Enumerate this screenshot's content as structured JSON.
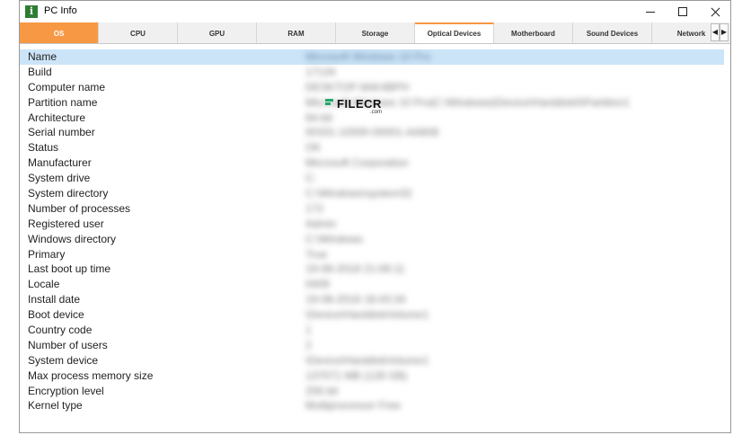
{
  "window": {
    "title": "PC Info",
    "app_icon_letter": "i"
  },
  "tabs": [
    {
      "label": "OS",
      "state": "active"
    },
    {
      "label": "CPU",
      "state": "normal"
    },
    {
      "label": "GPU",
      "state": "normal"
    },
    {
      "label": "RAM",
      "state": "normal"
    },
    {
      "label": "Storage",
      "state": "normal"
    },
    {
      "label": "Optical Devices",
      "state": "hover"
    },
    {
      "label": "Motherboard",
      "state": "normal"
    },
    {
      "label": "Sound Devices",
      "state": "normal"
    },
    {
      "label": "Network",
      "state": "normal"
    }
  ],
  "tab_scroll": {
    "left": "◀",
    "right": "▶"
  },
  "properties": [
    {
      "name": "Name",
      "value": "Microsoft Windows 10 Pro",
      "selected": true
    },
    {
      "name": "Build",
      "value": "17134"
    },
    {
      "name": "Computer name",
      "value": "DESKTOP-9AK4BPH"
    },
    {
      "name": "Partition name",
      "value": "Microsoft Windows 10 Pro|C:\\Windows|\\Device\\Harddisk0\\Partition1"
    },
    {
      "name": "Architecture",
      "value": "64-bit"
    },
    {
      "name": "Serial number",
      "value": "00331-10000-00001-AA608"
    },
    {
      "name": "Status",
      "value": "OK"
    },
    {
      "name": "Manufacturer",
      "value": "Microsoft Corporation"
    },
    {
      "name": "System drive",
      "value": "C:"
    },
    {
      "name": "System directory",
      "value": "C:\\Windows\\system32"
    },
    {
      "name": "Number of processes",
      "value": "172"
    },
    {
      "name": "Registered user",
      "value": "Admin"
    },
    {
      "name": "Windows directory",
      "value": "C:\\Windows"
    },
    {
      "name": "Primary",
      "value": "True"
    },
    {
      "name": "Last boot up time",
      "value": "19-08-2018 21:06:11"
    },
    {
      "name": "Locale",
      "value": "0409"
    },
    {
      "name": "Install date",
      "value": "19-08-2018 18:43:34"
    },
    {
      "name": "Boot device",
      "value": "\\Device\\HarddiskVolume1"
    },
    {
      "name": "Country code",
      "value": "1"
    },
    {
      "name": "Number of users",
      "value": "2"
    },
    {
      "name": "System device",
      "value": "\\Device\\HarddiskVolume1"
    },
    {
      "name": "Max process memory size",
      "value": "137071 MB (128 GB)"
    },
    {
      "name": "Encryption level",
      "value": "256 bit"
    },
    {
      "name": "Kernel type",
      "value": "Multiprocessor Free"
    }
  ],
  "watermark": {
    "brand": "FILECR",
    "sub": ".com"
  },
  "colors": {
    "accent": "#f79845",
    "selection": "#cce4f7",
    "app_icon": "#2e7d32"
  }
}
